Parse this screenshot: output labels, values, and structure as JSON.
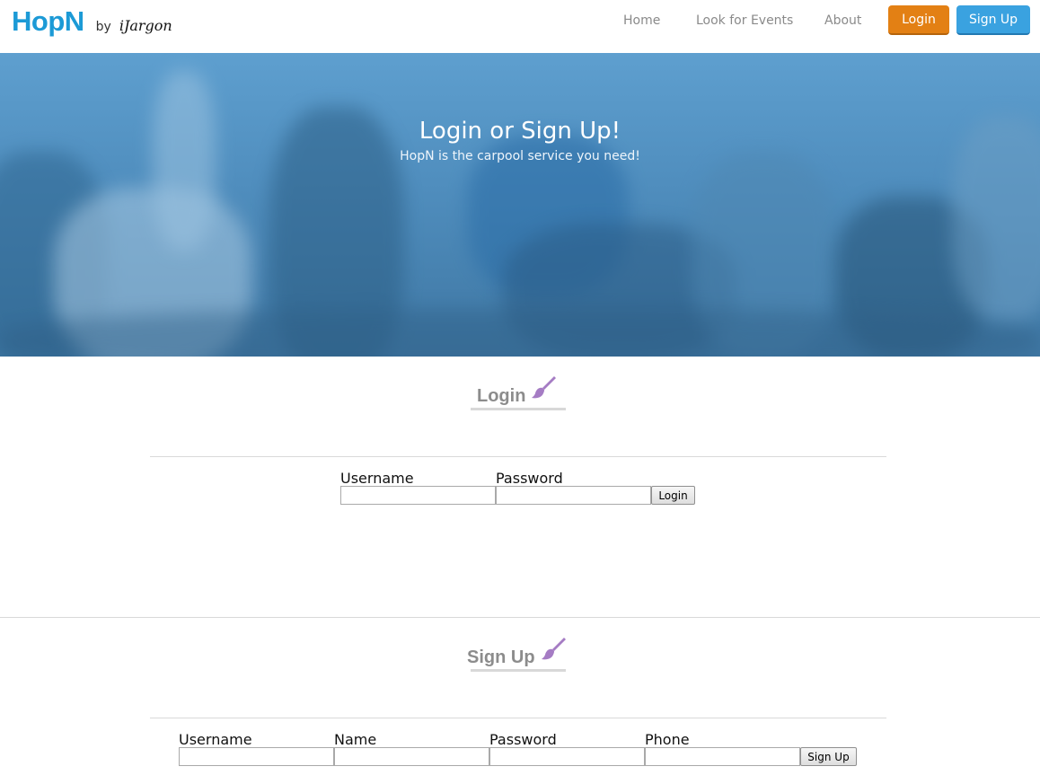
{
  "brand": {
    "logo": "HopN",
    "by": "by",
    "company": "iJargon",
    "logo_color": "#1c9ad6"
  },
  "nav": {
    "home": "Home",
    "events": "Look for Events",
    "about": "About",
    "login_button": "Login",
    "signup_button": "Sign Up",
    "login_color": "#e38014",
    "signup_color": "#3aa2e0"
  },
  "hero": {
    "title": "Login or Sign Up!",
    "subtitle": "HopN is the carpool service you need!"
  },
  "login": {
    "heading": "Login",
    "heading_icon": "paintbrush-icon",
    "username_label": "Username",
    "password_label": "Password",
    "username_value": "",
    "password_value": "",
    "submit_label": "Login"
  },
  "signup": {
    "heading": "Sign Up",
    "heading_icon": "paintbrush-icon",
    "username_label": "Username",
    "name_label": "Name",
    "password_label": "Password",
    "phone_label": "Phone",
    "username_value": "",
    "name_value": "",
    "password_value": "",
    "phone_value": "",
    "submit_label": "Sign Up"
  },
  "accent": {
    "icon_color": "#a57cc4"
  }
}
